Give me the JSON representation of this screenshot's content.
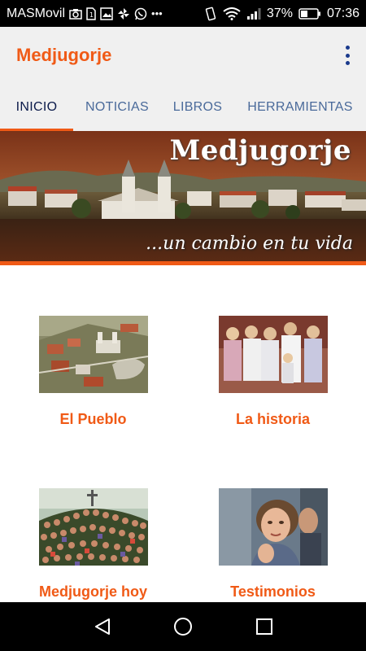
{
  "status_bar": {
    "carrier": "MASMovil",
    "battery": "37%",
    "time": "07:36"
  },
  "app_bar": {
    "title": "Medjugorje"
  },
  "tabs": [
    {
      "label": "INICIO",
      "active": true
    },
    {
      "label": "NOTICIAS",
      "active": false
    },
    {
      "label": "LIBROS",
      "active": false
    },
    {
      "label": "HERRAMIENTAS",
      "active": false
    }
  ],
  "banner": {
    "title": "Medjugorje",
    "subtitle": "...un cambio en tu vida"
  },
  "items": [
    {
      "label": "El Pueblo"
    },
    {
      "label": "La historia"
    },
    {
      "label": "Medjugorje hoy"
    },
    {
      "label": "Testimonios"
    }
  ],
  "colors": {
    "accent": "#f05a16",
    "tab_active": "#0b1a4a",
    "tab_inactive": "#4a6a9a",
    "app_bar_bg": "#f0f0f0"
  }
}
